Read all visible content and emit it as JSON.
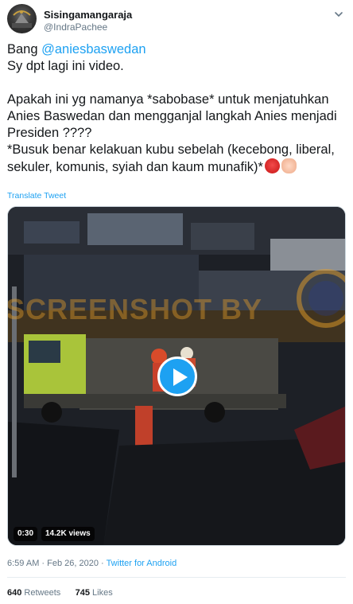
{
  "author": {
    "display_name": "Sisingamangaraja",
    "handle": "@IndraPachee"
  },
  "tweet": {
    "line1_prefix": "Bang ",
    "line1_mention": "@aniesbaswedan",
    "line2": "Sy dpt lagi ini video.",
    "line3": "Apakah ini yg namanya *sabobase* untuk menjatuhkan",
    "line4": "Anies Baswedan dan mengganjal langkah Anies menjadi",
    "line5": "Presiden ????",
    "line6": " *Busuk benar kelakuan kubu sebelah (kecebong, liberal,",
    "line7": "sekuler, komunis, syiah dan kaum munafik)*",
    "emojis": [
      "angry-face-emoji",
      "raised-fist-emoji"
    ]
  },
  "translate_label": "Translate Tweet",
  "media": {
    "watermark_text": "SCREENSHOT BY",
    "duration": "0:30",
    "views": "14.2K views"
  },
  "meta": {
    "time": "6:59 AM",
    "separator1": " · ",
    "date": "Feb 26, 2020",
    "separator2": " · ",
    "source": "Twitter for Android"
  },
  "stats": {
    "retweets_count": "640",
    "retweets_label": " Retweets",
    "likes_count": "745",
    "likes_label": " Likes"
  },
  "colors": {
    "accent": "#1da1f2",
    "text": "#14171a",
    "secondary": "#657786"
  }
}
